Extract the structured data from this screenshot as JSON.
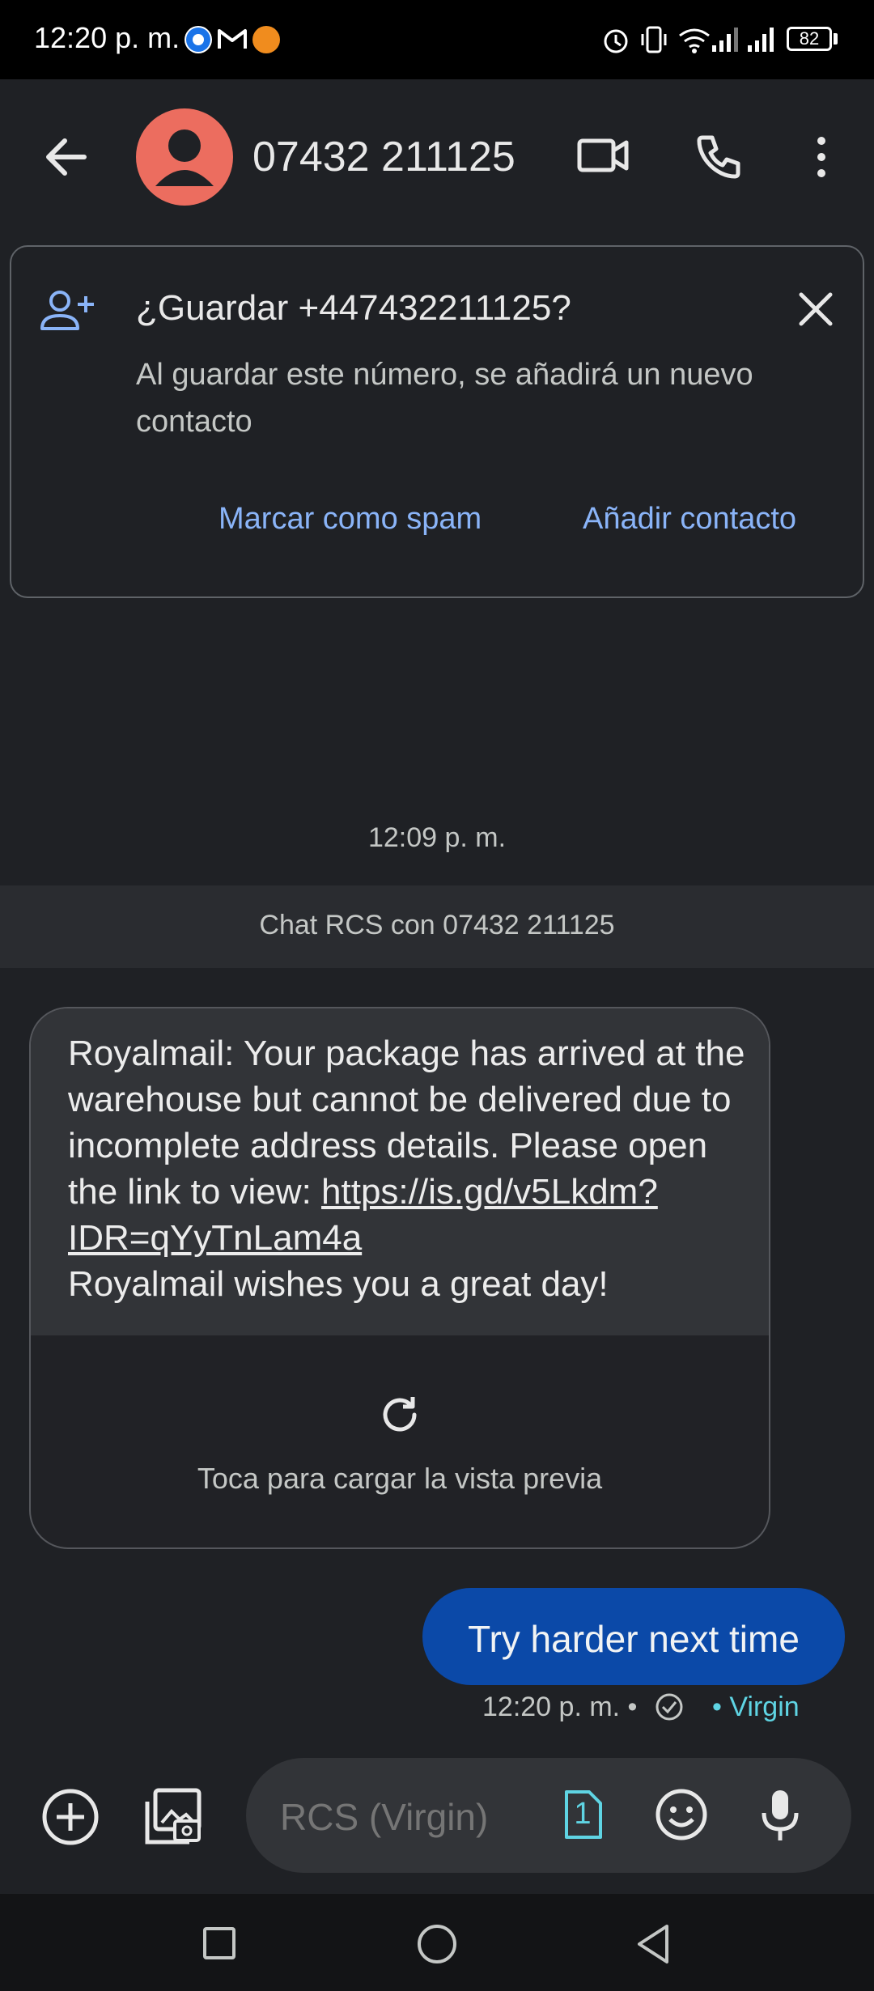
{
  "status_bar": {
    "time": "12:20 p. m.",
    "battery": "82"
  },
  "header": {
    "contact_name": "07432 211125"
  },
  "save_card": {
    "title": "¿Guardar +447432211125?",
    "description": "Al guardar este número, se añadirá un nuevo contacto",
    "spam_button": "Marcar como spam",
    "add_button": "Añadir contacto"
  },
  "conversation": {
    "time_divider": "12:09 p. m.",
    "rcs_banner": "Chat RCS con 07432 211125",
    "incoming": {
      "text_before": "Royalmail: Your package has arrived at the warehouse but cannot be delivered due to incomplete address details. Please open the link to view: ",
      "link": "https://is.gd/v5Lkdm?IDR=qYyTnLam4a",
      "text_after": "Royalmail wishes you a great day!",
      "preview_label": "Toca para cargar la vista previa"
    },
    "outgoing": {
      "text": "Try harder next time",
      "meta": "12:20 p. m. •",
      "carrier": "• Virgin"
    }
  },
  "compose": {
    "placeholder": "RCS (Virgin)",
    "sim_number": "1"
  },
  "colors": {
    "accent_link": "#8ab4f8",
    "outgoing_bubble": "#0b49a8",
    "avatar": "#ec6d5f",
    "carrier": "#5fd4e3"
  }
}
